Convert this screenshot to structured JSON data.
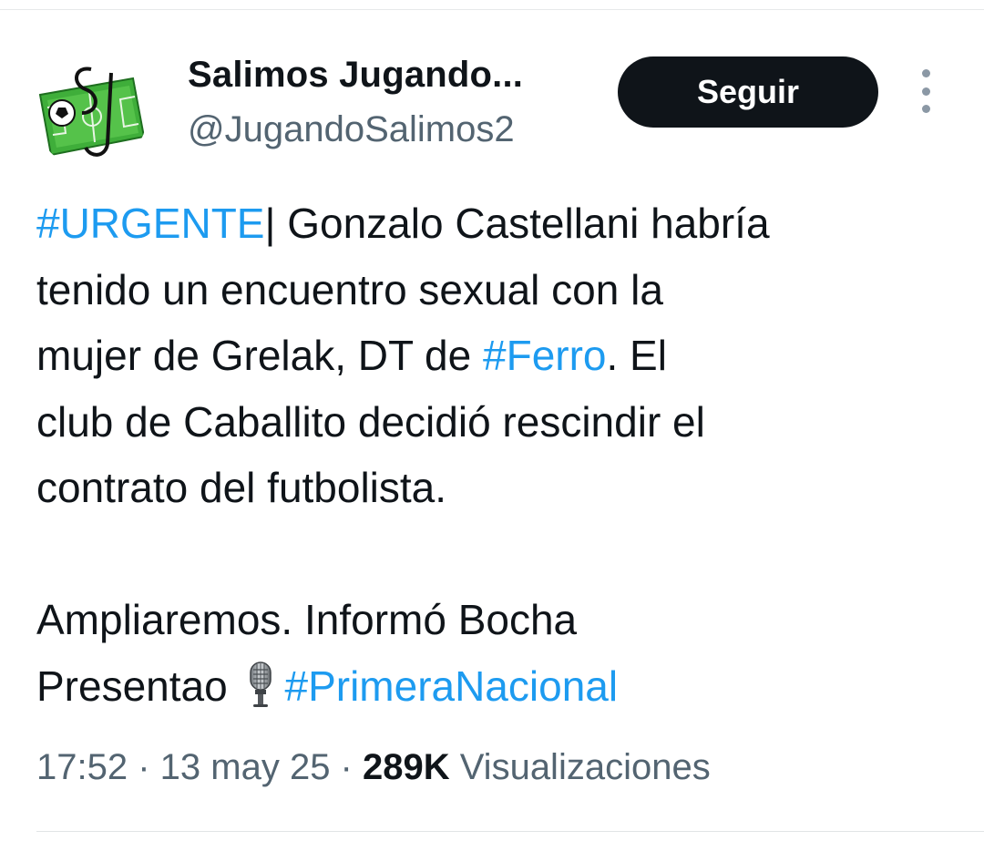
{
  "author": {
    "display_name": "Salimos Jugando...",
    "handle": "@JugandoSalimos2",
    "avatar_icon": "salimos-jugando-logo",
    "follow_label": "Seguir",
    "more_icon": "vertical-ellipsis-icon"
  },
  "tweet": {
    "line1_hashtag": "#URGENTE",
    "line1_text": "| Gonzalo Castellani habría",
    "line2_text": "tenido un encuentro sexual con la",
    "line3_text": "mujer de Grelak, DT de ",
    "line3_hashtag": "#Ferro",
    "line3_tail": ". El",
    "line4_text": "club de Caballito decidió rescindir el",
    "line5_text": "contrato del futbolista.",
    "line6_text": "Ampliaremos. Informó Bocha",
    "line7_text": "Presentao ",
    "line7_icon": "microphone-icon",
    "line7_hashtag": "#PrimeraNacional"
  },
  "meta": {
    "time": "17:52",
    "separator": " · ",
    "date": "13 may 25",
    "views_count": "289K",
    "views_label": " Visualizaciones"
  },
  "colors": {
    "link": "#1d9bf0",
    "text": "#0f1419",
    "secondary": "#536471",
    "button_bg": "#0f1419",
    "button_text": "#ffffff"
  }
}
